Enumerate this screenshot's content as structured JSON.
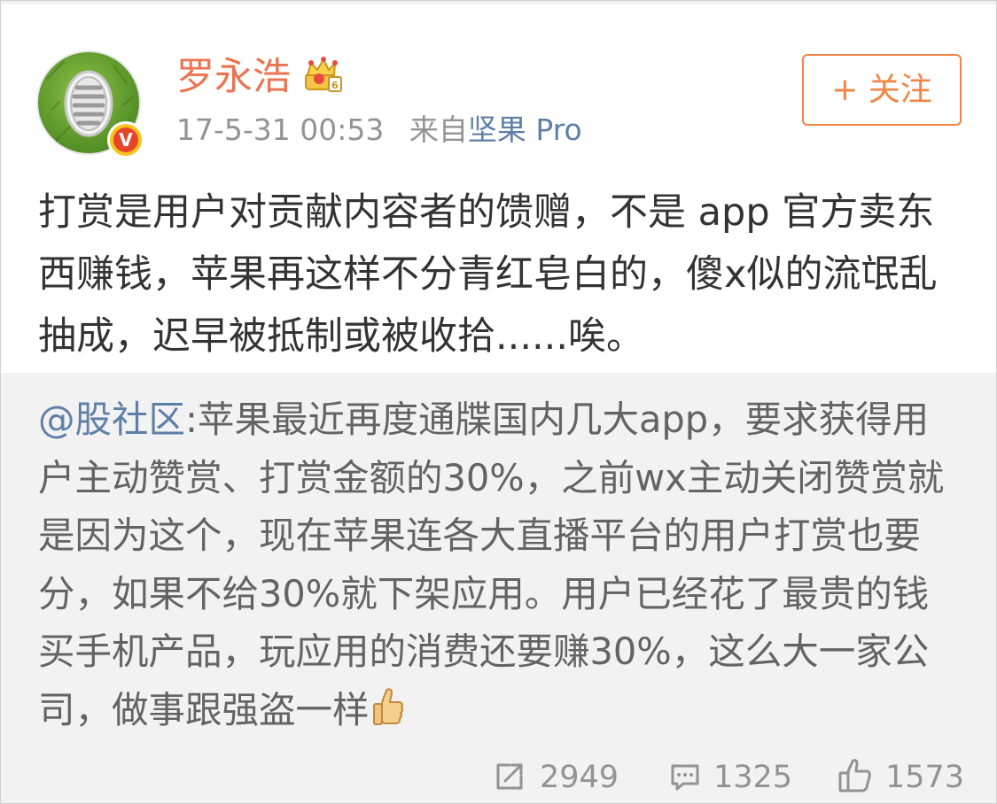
{
  "user": {
    "name": "罗永浩",
    "verified_badge": "V",
    "crown_icon": "crown-icon"
  },
  "meta": {
    "timestamp": "17-5-31 00:53",
    "source_prefix": "来自",
    "source": "坚果 Pro"
  },
  "follow_button": {
    "label": "+ 关注"
  },
  "post": {
    "text": "打赏是用户对贡献内容者的馈赠，不是 app 官方卖东西赚钱，苹果再这样不分青红皂白的，傻x似的流氓乱抽成，迟早被抵制或被收拾......唉。"
  },
  "repost": {
    "mention": "@股社区",
    "text": ":苹果最近再度通牒国内几大app，要求获得用户主动赞赏、打赏金额的30%，之前wx主动关闭赞赏就是因为这个，现在苹果连各大直播平台的用户打赏也要分，如果不给30%就下架应用。用户已经花了最贵的钱买手机产品，玩应用的消费还要赚30%，这么大一家公司，做事跟强盗一样",
    "emoji": "thumbs-up-icon"
  },
  "actions": {
    "repost_count": "2949",
    "comment_count": "1325",
    "like_count": "1573"
  },
  "colors": {
    "username": "#eb7350",
    "link": "#5e7fa7",
    "follow": "#f28545",
    "muted": "#939393",
    "repost_bg": "#f2f2f2"
  }
}
